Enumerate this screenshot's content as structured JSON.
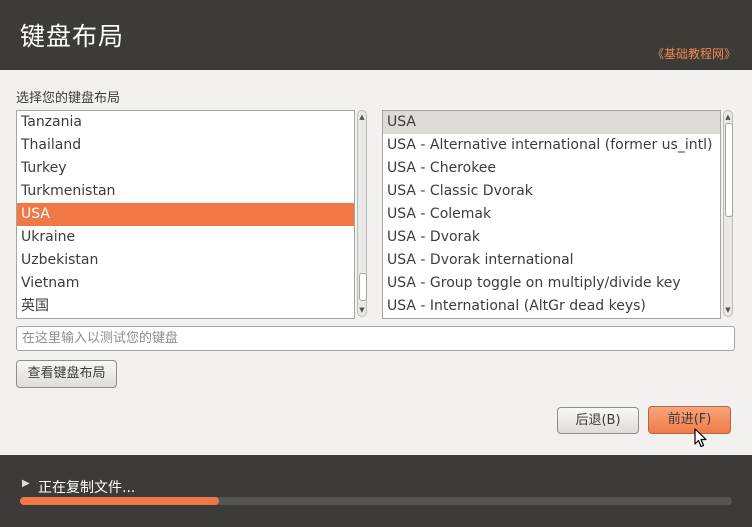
{
  "header": {
    "title": "键盘布局",
    "watermark": "《基础教程网》"
  },
  "prompt": "选择您的键盘布局",
  "country_list": {
    "items": [
      "Tanzania",
      "Thailand",
      "Turkey",
      "Turkmenistan",
      "USA",
      "Ukraine",
      "Uzbekistan",
      "Vietnam",
      "英国"
    ],
    "selected": "USA"
  },
  "variant_list": {
    "items": [
      "USA",
      "USA - Alternative international (former us_intl)",
      "USA - Cherokee",
      "USA - Classic Dvorak",
      "USA - Colemak",
      "USA - Dvorak",
      "USA - Dvorak international",
      "USA - Group toggle on multiply/divide key",
      "USA - International (AltGr dead keys)"
    ],
    "selected": "USA"
  },
  "test_input": {
    "placeholder": "在这里输入以测试您的键盘",
    "value": ""
  },
  "buttons": {
    "view_layout": "查看键盘布局",
    "back": "后退(B)",
    "forward": "前进(F)"
  },
  "footer": {
    "status": "正在复制文件...",
    "progress": 0.28
  },
  "colors": {
    "accent": "#f07746",
    "header_bg": "#3c3b37",
    "window_bg": "#f2f1f0"
  }
}
